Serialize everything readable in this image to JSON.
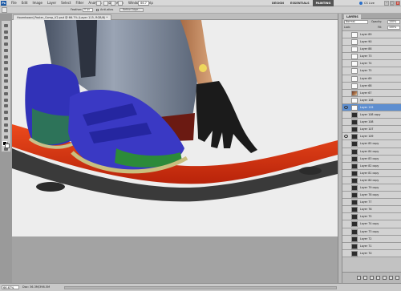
{
  "app": {
    "logo": "Ps",
    "menu": [
      "File",
      "Edit",
      "Image",
      "Layer",
      "Select",
      "Filter",
      "Analysis",
      "3D",
      "View",
      "Window",
      "Help"
    ],
    "zoom_box": "66.7",
    "workspaces": [
      "DESIGN",
      "ESSENTIALS",
      "PAINTING"
    ],
    "active_workspace": "PAINTING",
    "cs_live": "CS Live",
    "window_buttons": [
      "–",
      "□",
      "×"
    ]
  },
  "options": {
    "feather_label": "Feather:",
    "feather_value": "0 px",
    "antialias_label": "Anti-alias",
    "refine_edge_label": "Refine Edge..."
  },
  "document": {
    "tab_label": "Hoverboard_Poster_Comp_V2.psd @ 66.7% (Layer 115, RGB/8) *"
  },
  "layers": {
    "panel_title": "LAYERS",
    "blend_mode": "Normal",
    "opacity_label": "Opacity:",
    "opacity_value": "100%",
    "lock_label": "Lock:",
    "fill_label": "Fill:",
    "fill_value": "100%",
    "rows": [
      {
        "name": "Layer 89",
        "thumb": "light",
        "visible": false
      },
      {
        "name": "Layer 90",
        "thumb": "light",
        "visible": false
      },
      {
        "name": "Layer 88",
        "thumb": "light",
        "visible": false
      },
      {
        "name": "Layer 73",
        "thumb": "light",
        "visible": false
      },
      {
        "name": "Layer 74",
        "thumb": "light",
        "visible": false
      },
      {
        "name": "Layer 75",
        "thumb": "light",
        "visible": false
      },
      {
        "name": "Layer 69",
        "thumb": "light",
        "visible": false
      },
      {
        "name": "Layer 68",
        "thumb": "light",
        "visible": false
      },
      {
        "name": "Layer 67",
        "thumb": "img",
        "visible": false
      },
      {
        "name": "Layer 106",
        "thumb": "light",
        "visible": false
      },
      {
        "name": "Layer 115",
        "thumb": "light",
        "visible": true,
        "selected": true
      },
      {
        "name": "Layer 108 copy",
        "thumb": "dark",
        "visible": false
      },
      {
        "name": "Layer 108",
        "thumb": "dark",
        "visible": false
      },
      {
        "name": "Layer 107",
        "thumb": "dark",
        "visible": false
      },
      {
        "name": "Layer 109",
        "thumb": "dark",
        "visible": true
      },
      {
        "name": "Layer 85 copy",
        "thumb": "dark",
        "visible": false
      },
      {
        "name": "Layer 84 copy",
        "thumb": "dark",
        "visible": false
      },
      {
        "name": "Layer 83 copy",
        "thumb": "dark",
        "visible": false
      },
      {
        "name": "Layer 82 copy",
        "thumb": "dark",
        "visible": false
      },
      {
        "name": "Layer 81 copy",
        "thumb": "dark",
        "visible": false
      },
      {
        "name": "Layer 80 copy",
        "thumb": "dark",
        "visible": false
      },
      {
        "name": "Layer 79 copy",
        "thumb": "dark",
        "visible": false
      },
      {
        "name": "Layer 78 copy",
        "thumb": "dark",
        "visible": false
      },
      {
        "name": "Layer 77",
        "thumb": "dark",
        "visible": false
      },
      {
        "name": "Layer 76",
        "thumb": "dark",
        "visible": false
      },
      {
        "name": "Layer 75",
        "thumb": "dark",
        "visible": false
      },
      {
        "name": "Layer 74 copy",
        "thumb": "dark",
        "visible": false
      },
      {
        "name": "Layer 73 copy",
        "thumb": "dark",
        "visible": false
      },
      {
        "name": "Layer 72",
        "thumb": "dark",
        "visible": false
      },
      {
        "name": "Layer 71",
        "thumb": "dark",
        "visible": false
      },
      {
        "name": "Layer 70",
        "thumb": "dark",
        "visible": false
      }
    ]
  },
  "status": {
    "zoom": "66.67%",
    "doc_info": "Doc: 36.3M/398.5M"
  },
  "colors": {
    "selection_blue": "#5d8ed0",
    "hoverboard_red": "#d8330f",
    "sneaker_blue": "#3132b8",
    "sneaker_green": "#2c8a3a",
    "glove_black": "#1b1b1b"
  }
}
